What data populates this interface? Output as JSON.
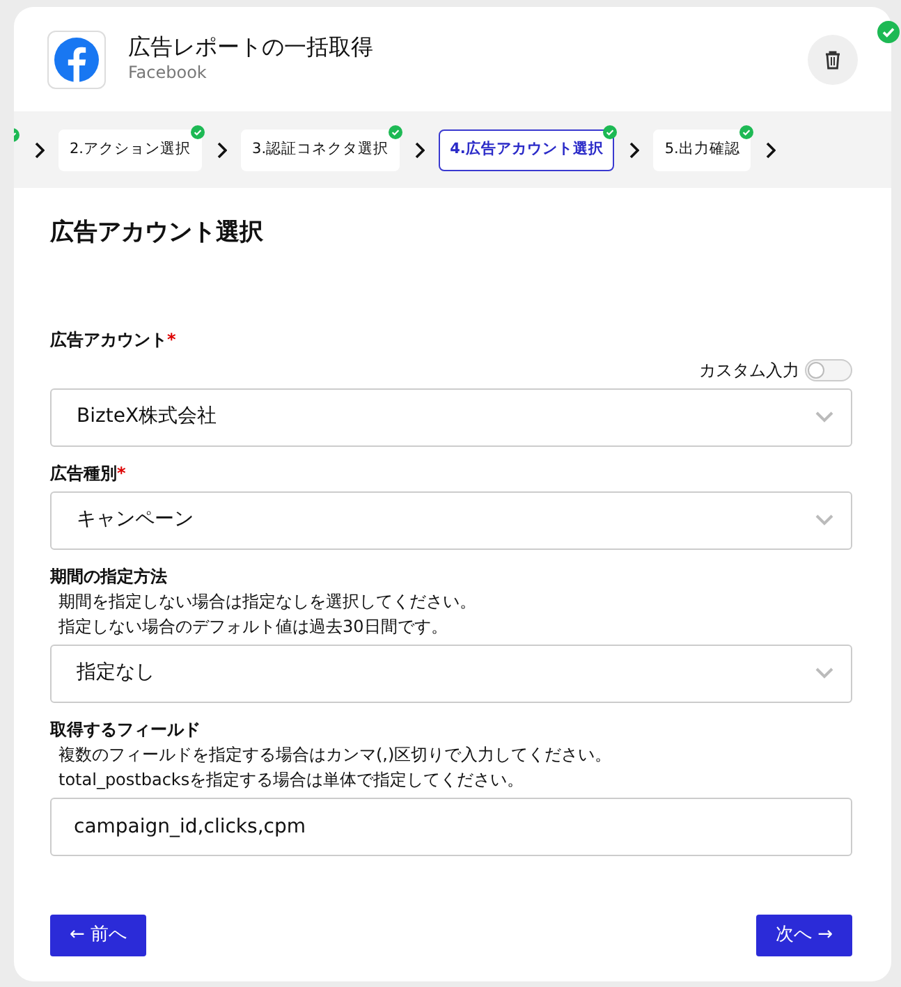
{
  "header": {
    "title": "広告レポートの一括取得",
    "subtitle": "Facebook",
    "status_ok": true
  },
  "steps": [
    {
      "kind": "partial",
      "completed": true
    },
    {
      "label": "2.アクション選択",
      "completed": true,
      "selected": false
    },
    {
      "label": "3.認証コネクタ選択",
      "completed": true,
      "selected": false
    },
    {
      "label": "4.広告アカウント選択",
      "completed": true,
      "selected": true
    },
    {
      "label": "5.出力確認",
      "completed": true,
      "selected": false
    }
  ],
  "section_title": "広告アカウント選択",
  "fields": [
    {
      "kind": "select",
      "label": "広告アカウント",
      "required_mark": "*",
      "toggle": {
        "label": "カスタム入力",
        "on": false
      },
      "value": "BizteX株式会社"
    },
    {
      "kind": "select",
      "label": "広告種別",
      "required_mark": "*",
      "value": "キャンペーン"
    },
    {
      "kind": "select",
      "label": "期間の指定方法",
      "help": [
        "期間を指定しない場合は指定なしを選択してください。",
        "指定しない場合のデフォルト値は過去30日間です。"
      ],
      "value": "指定なし"
    },
    {
      "kind": "text",
      "label": "取得するフィールド",
      "help": [
        "複数のフィールドを指定する場合はカンマ(,)区切りで入力してください。",
        "total_postbacksを指定する場合は単体で指定してください。"
      ],
      "value": "campaign_id,clicks,cpm"
    }
  ],
  "buttons": {
    "back": "← 前へ",
    "next": "次へ →"
  }
}
